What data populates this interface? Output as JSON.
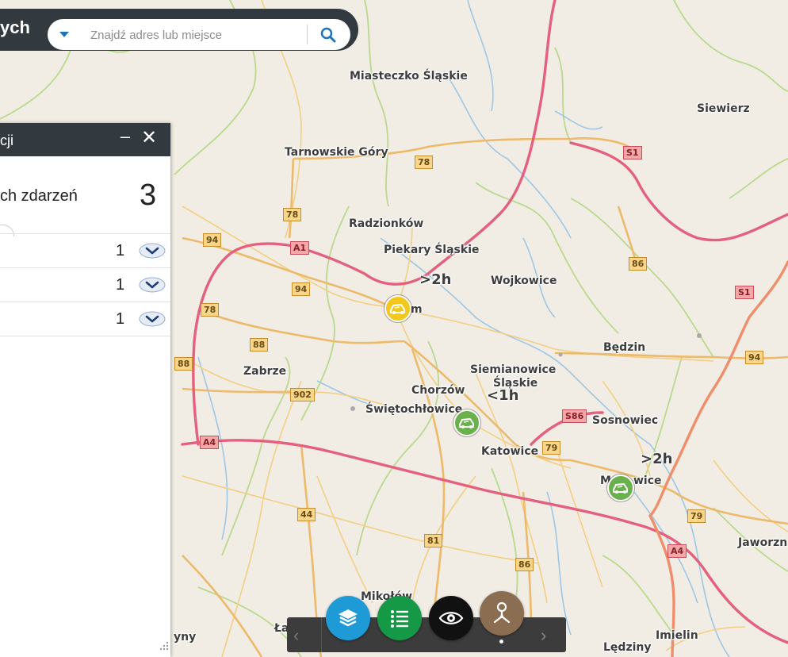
{
  "search": {
    "title_fragment": "ych",
    "placeholder": "Znajdź adres lub miejsce"
  },
  "panel": {
    "title_fragment": "acji",
    "minimize_label": "–",
    "close_label": "✕",
    "summary_label_fragment": "ych zdarzeń",
    "summary_count": "3",
    "rows": [
      {
        "count": "1"
      },
      {
        "count": "1"
      },
      {
        "count": "1"
      }
    ]
  },
  "map": {
    "places": [
      {
        "name": "Miasteczko Śląskie"
      },
      {
        "name": "Siewierz"
      },
      {
        "name": "Tarnowskie Góry"
      },
      {
        "name": "Radzionków"
      },
      {
        "name": "Piekary Śląskie"
      },
      {
        "name": "Wojkowice"
      },
      {
        "name": "m"
      },
      {
        "name": "Będzin"
      },
      {
        "name": "Zabrze"
      },
      {
        "name": "Siemianowice"
      },
      {
        "name": "Śląskie"
      },
      {
        "name": "Chorzów"
      },
      {
        "name": "Świętochłowice"
      },
      {
        "name": "Sosnowiec"
      },
      {
        "name": "Katowice"
      },
      {
        "name": "M"
      },
      {
        "name": "wice"
      },
      {
        "name": "Jaworzn"
      },
      {
        "name": "Mikołów"
      },
      {
        "name": "Łaziska"
      },
      {
        "name": "Imielin"
      },
      {
        "name": "Lędziny"
      },
      {
        "name": "yny"
      }
    ],
    "road_shields": [
      {
        "label": "78",
        "class": "national"
      },
      {
        "label": "S1",
        "class": "expressway"
      },
      {
        "label": "78",
        "class": "national"
      },
      {
        "label": "94",
        "class": "national"
      },
      {
        "label": "A1",
        "class": "expressway"
      },
      {
        "label": "86",
        "class": "national"
      },
      {
        "label": "94",
        "class": "national"
      },
      {
        "label": "S1",
        "class": "expressway"
      },
      {
        "label": "78",
        "class": "national"
      },
      {
        "label": "88",
        "class": "national"
      },
      {
        "label": "88",
        "class": "national"
      },
      {
        "label": "94",
        "class": "national"
      },
      {
        "label": "902",
        "class": "national"
      },
      {
        "label": "S86",
        "class": "expressway"
      },
      {
        "label": "79",
        "class": "national"
      },
      {
        "label": "A4",
        "class": "expressway"
      },
      {
        "label": "79",
        "class": "national"
      },
      {
        "label": "44",
        "class": "national"
      },
      {
        "label": "A4",
        "class": "expressway"
      },
      {
        "label": "81",
        "class": "national"
      },
      {
        "label": "86",
        "class": "national"
      }
    ],
    "delay_labels": [
      ">2h",
      "<1h",
      ">2h"
    ],
    "markers": [
      {
        "status": "yellow",
        "icon": "car-accident-icon"
      },
      {
        "status": "green",
        "icon": "car-accident-icon"
      },
      {
        "status": "green",
        "icon": "car-accident-icon"
      }
    ]
  },
  "toolbar": {
    "prev_label": "‹",
    "next_label": "›",
    "buttons": [
      {
        "name": "layers",
        "color": "#1e9bd7"
      },
      {
        "name": "legend",
        "color": "#159947"
      },
      {
        "name": "visibility",
        "color": "#111111"
      },
      {
        "name": "route",
        "color": "#8b6e52"
      }
    ]
  },
  "colors": {
    "map_background": "#f1ede4",
    "expressway": "#e4607f",
    "national_road": "#f0c070",
    "water": "#9dc7e6",
    "boundary": "#b9d98c",
    "header": "#333a3f",
    "accent": "#1e73be"
  }
}
